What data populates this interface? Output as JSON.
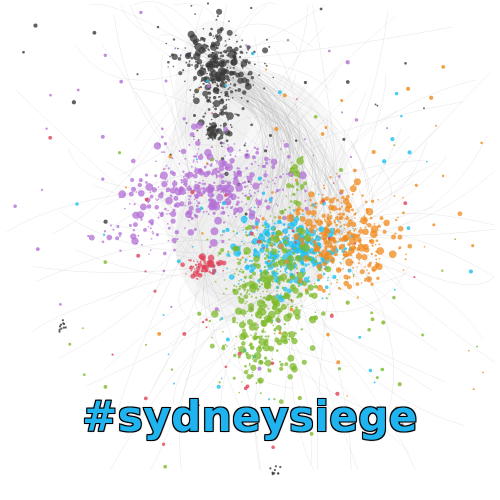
{
  "caption": {
    "hashtag": "#sydneysiege"
  },
  "colors": {
    "background": "#ffffff",
    "edges": "#b9b9b9",
    "hashtag_fill": "#1fb3ef",
    "hashtag_outline": "#000000",
    "cluster_dark_gray": "#3a3a3a",
    "cluster_purple": "#b36fd6",
    "cluster_cyan": "#1ec0ef",
    "cluster_orange": "#f08a1c",
    "cluster_green": "#7dba2a",
    "cluster_red": "#e0435a"
  },
  "clusters": [
    {
      "name": "dark-gray-cluster",
      "color": "cluster_dark_gray"
    },
    {
      "name": "purple-cluster",
      "color": "cluster_purple"
    },
    {
      "name": "cyan-cluster",
      "color": "cluster_cyan"
    },
    {
      "name": "orange-cluster",
      "color": "cluster_orange"
    },
    {
      "name": "green-cluster",
      "color": "cluster_green"
    },
    {
      "name": "red-cluster",
      "color": "cluster_red"
    }
  ]
}
